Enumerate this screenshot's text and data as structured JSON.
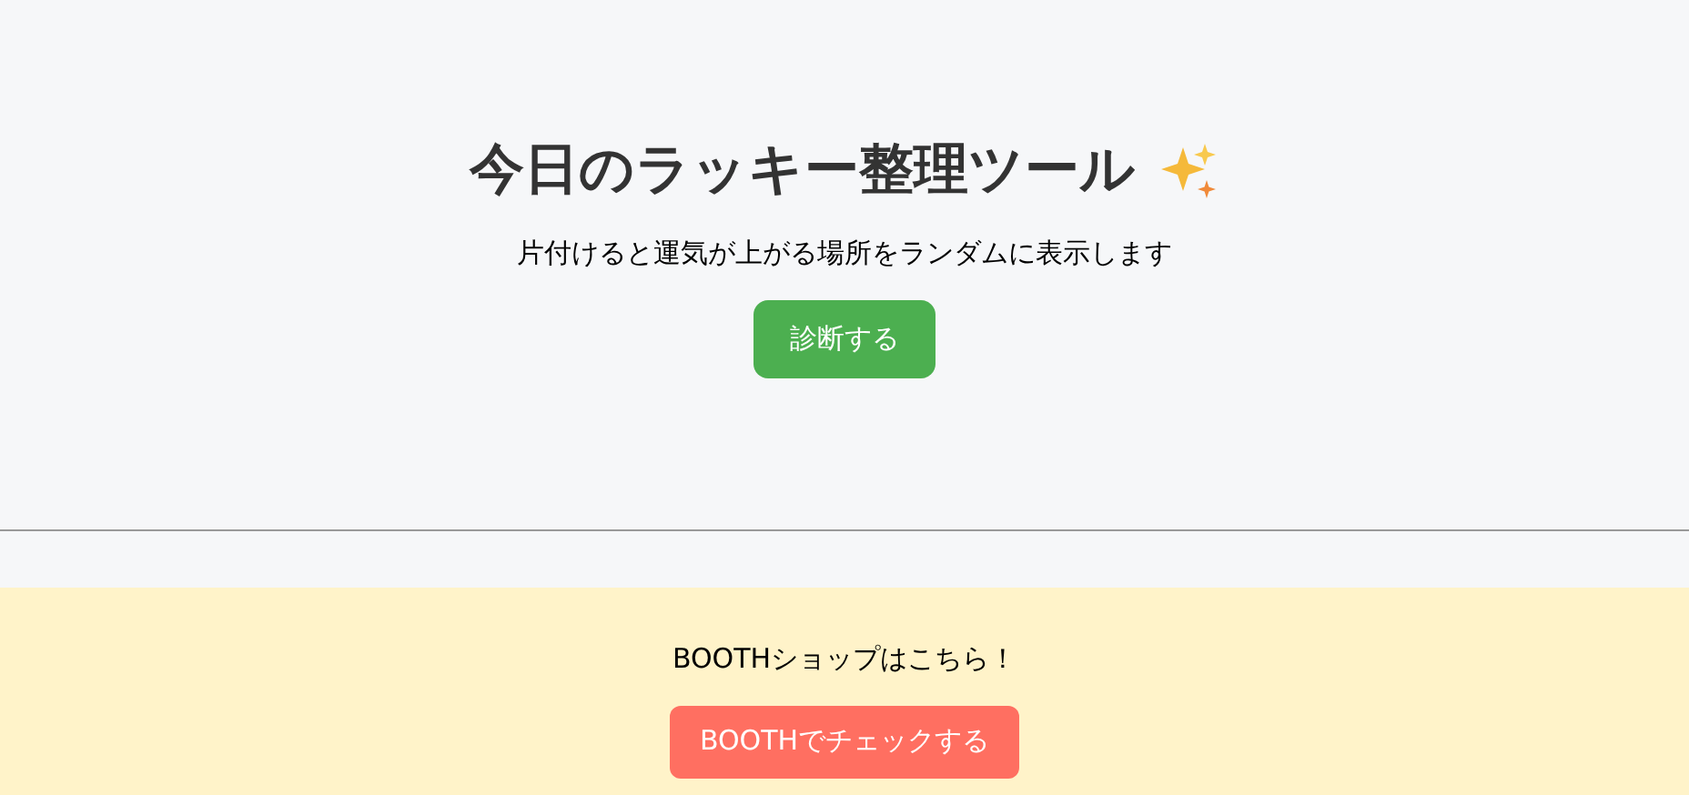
{
  "header": {
    "title": "今日のラッキー整理ツール",
    "subtitle": "片付けると運気が上がる場所をランダムに表示します",
    "button": "診断する"
  },
  "shop": {
    "text": "BOOTHショップはこちら！",
    "button": "BOOTHでチェックする"
  }
}
